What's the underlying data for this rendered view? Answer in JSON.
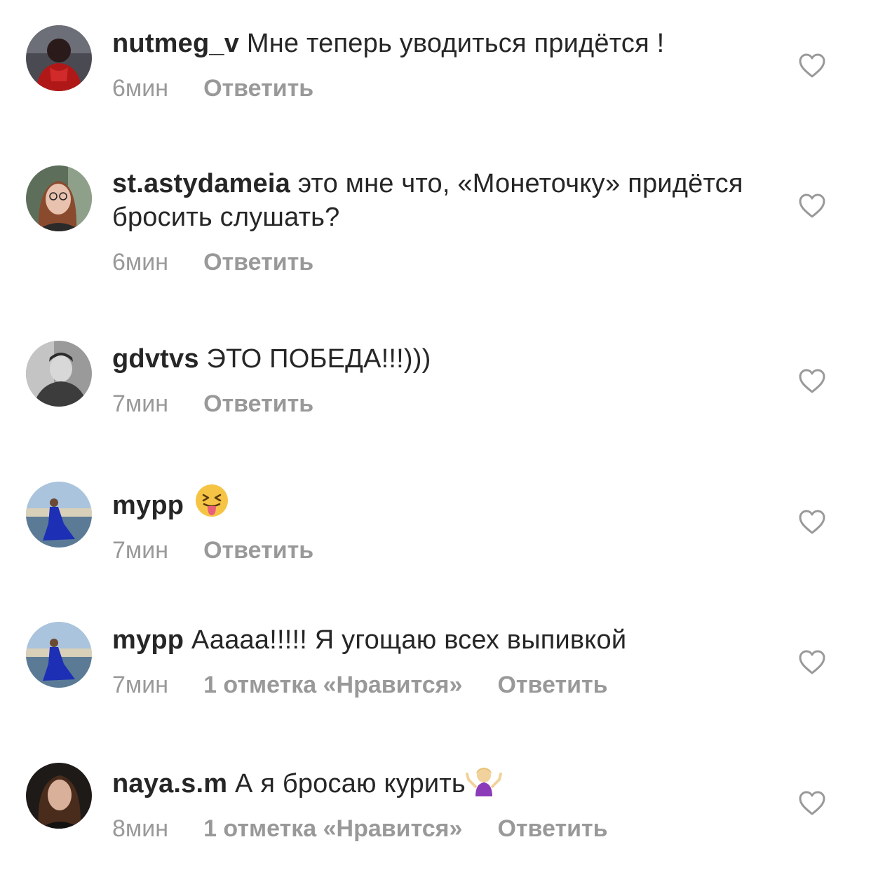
{
  "colors": {
    "text": "#262626",
    "meta": "#999999",
    "heart_stroke": "#999999"
  },
  "comments": [
    {
      "username": "nutmeg_v",
      "text": "Мне теперь уводиться придётся !",
      "time": "6мин",
      "likes": "",
      "reply": "Ответить",
      "avatar_icon": "avatar-red-coat"
    },
    {
      "username": "st.astydameia",
      "text": "это мне что, «Монеточку» придётся бросить слушать?",
      "time": "6мин",
      "likes": "",
      "reply": "Ответить",
      "avatar_icon": "avatar-glasses-woman"
    },
    {
      "username": "gdvtvs",
      "text": "ЭТО ПОБЕДА!!!)))",
      "time": "7мин",
      "likes": "",
      "reply": "Ответить",
      "avatar_icon": "avatar-grayscale-man"
    },
    {
      "username": "mypp",
      "text": "",
      "emoji": "squinting-tongue-emoji",
      "time": "7мин",
      "likes": "",
      "reply": "Ответить",
      "avatar_icon": "avatar-blue-dress"
    },
    {
      "username": "mypp",
      "text": "Ааааа!!!!! Я угощаю всех выпивкой",
      "time": "7мин",
      "likes": "1 отметка «Нравится»",
      "reply": "Ответить",
      "avatar_icon": "avatar-blue-dress"
    },
    {
      "username": "naya.s.m",
      "text": "А я бросаю курить",
      "emoji": "shrug-emoji",
      "time": "8мин",
      "likes": "1 отметка «Нравится»",
      "reply": "Ответить",
      "avatar_icon": "avatar-dark-woman"
    }
  ]
}
